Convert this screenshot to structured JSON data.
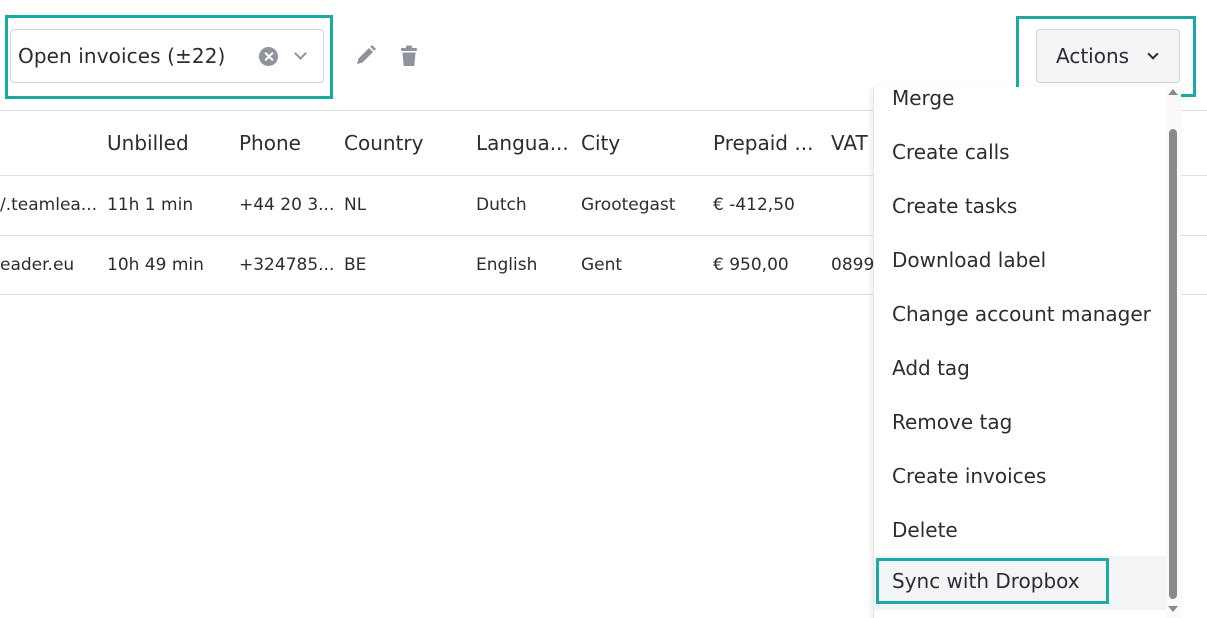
{
  "toolbar": {
    "view_select_value": "Open invoices (±22)",
    "clear_icon": "close-circle-icon",
    "dropdown_icon": "chevron-down-icon",
    "edit_icon": "pencil-icon",
    "delete_icon": "trash-icon",
    "actions_label": "Actions"
  },
  "table": {
    "columns": [
      "Unbilled",
      "Phone",
      "Country",
      "Langua...",
      "City",
      "Prepaid ...",
      "VAT"
    ],
    "rows": [
      {
        "website": "/.teamlea...",
        "unbilled": "11h 1 min",
        "phone": "+44 20 3...",
        "country": "NL",
        "language": "Dutch",
        "city": "Grootegast",
        "prepaid": "€ -412,50",
        "vat": ""
      },
      {
        "website": "eader.eu",
        "unbilled": "10h 49 min",
        "phone": "+324785...",
        "country": "BE",
        "language": "English",
        "city": "Gent",
        "prepaid": "€ 950,00",
        "vat": "0899"
      }
    ]
  },
  "actions_menu": {
    "items": [
      "Merge",
      "Create calls",
      "Create tasks",
      "Download label",
      "Change account manager",
      "Add tag",
      "Remove tag",
      "Create invoices",
      "Delete",
      "Sync with Dropbox"
    ]
  },
  "colors": {
    "highlight": "#1aa9a3",
    "text": "#2c2c34",
    "icon_gray": "#8f939c"
  }
}
